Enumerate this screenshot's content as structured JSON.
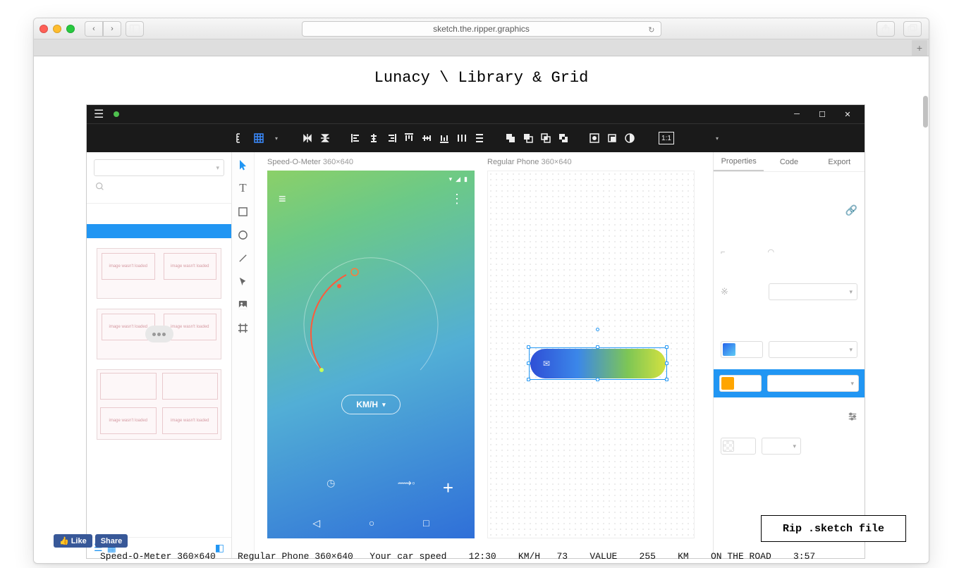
{
  "browser": {
    "url": "sketch.the.ripper.graphics"
  },
  "page_title": "Lunacy \\ Library & Grid",
  "app": {
    "artboard1": {
      "name": "Speed-O-Meter",
      "dims": "360×640",
      "chip": "KM/H"
    },
    "artboard2": {
      "name": "Regular Phone",
      "dims": "360×640"
    },
    "tabs": {
      "t1": "Properties",
      "t2": "Code",
      "t3": "Export"
    }
  },
  "rip_button": "Rip .sketch file",
  "like": "Like",
  "share": "Share",
  "thumb_placeholder": "image wasn't loaded",
  "inv_line": "Speed-O-Meter 360×640    Regular Phone 360×640   Your car speed    12:30    KM/H   73    VALUE    255    KM    ON THE ROAD    3:57"
}
